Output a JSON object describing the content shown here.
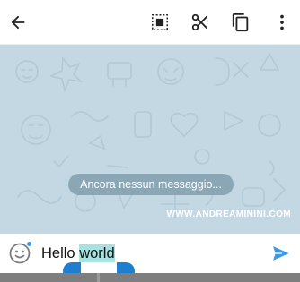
{
  "toolbar": {
    "icons": [
      "back-arrow-icon",
      "select-all-icon",
      "cut-icon",
      "copy-icon",
      "more-vertical-icon"
    ]
  },
  "chat": {
    "empty_message": "Ancora nessun messaggio...",
    "watermark": "WWW.ANDREAMININI.COM",
    "background_color": "#c4d8e3"
  },
  "composer": {
    "text_before": "Hello ",
    "selected_text": "world",
    "selection_color": "#a6e3e0",
    "send_color": "#3d9ae8"
  }
}
